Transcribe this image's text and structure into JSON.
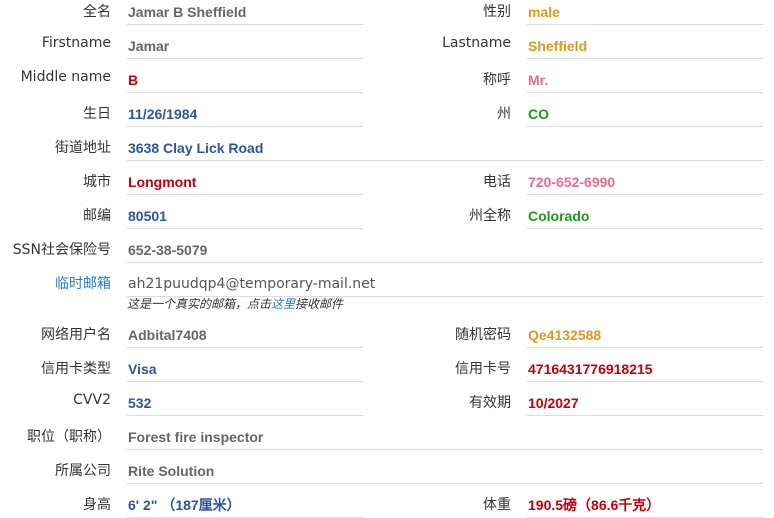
{
  "colors": {
    "label": "#333333",
    "gray": "#666666",
    "blue": "#2f5597",
    "red": "#c0000b",
    "orange": "#d99a1e",
    "pink": "#ee6a8c",
    "green": "#1a9a1a",
    "link": "#2a7ac4"
  },
  "fields": {
    "fullname": {
      "label": "全名",
      "value": "Jamar B Sheffield"
    },
    "gender": {
      "label": "性别",
      "value": "male"
    },
    "firstname": {
      "label": "Firstname",
      "value": "Jamar"
    },
    "lastname": {
      "label": "Lastname",
      "value": "Sheffield"
    },
    "middlename": {
      "label": "Middle name",
      "value": "B"
    },
    "title": {
      "label": "称呼",
      "value": "Mr."
    },
    "birthday": {
      "label": "生日",
      "value": "11/26/1984"
    },
    "state": {
      "label": "州",
      "value": "CO"
    },
    "street": {
      "label": "街道地址",
      "value": "3638 Clay Lick Road"
    },
    "city": {
      "label": "城市",
      "value": "Longmont"
    },
    "phone": {
      "label": "电话",
      "value": "720-652-6990"
    },
    "zip": {
      "label": "邮编",
      "value": "80501"
    },
    "state_full": {
      "label": "州全称",
      "value": "Colorado"
    },
    "ssn": {
      "label": "SSN社会保险号",
      "value": "652-38-5079"
    },
    "email": {
      "label": "临时邮箱",
      "value": "ah21puudqp4@temporary-mail.net"
    },
    "username": {
      "label": "网络用户名",
      "value": "Adbital7408"
    },
    "password": {
      "label": "随机密码",
      "value": "Qe4132588"
    },
    "card_type": {
      "label": "信用卡类型",
      "value": "Visa"
    },
    "card_number": {
      "label": "信用卡号",
      "value": "4716431776918215"
    },
    "cvv2": {
      "label": "CVV2",
      "value": "532"
    },
    "expiry": {
      "label": "有效期",
      "value": "10/2027"
    },
    "occupation": {
      "label": "职位（职称）",
      "value": "Forest fire inspector"
    },
    "company": {
      "label": "所属公司",
      "value": "Rite Solution"
    },
    "height": {
      "label": "身高",
      "value": "6' 2\" （187厘米）"
    },
    "weight": {
      "label": "体重",
      "value": "190.5磅（86.6千克）"
    }
  },
  "email_note": {
    "before": "这是一个真实的邮箱，点击",
    "link": "这里",
    "after": "接收邮件"
  }
}
